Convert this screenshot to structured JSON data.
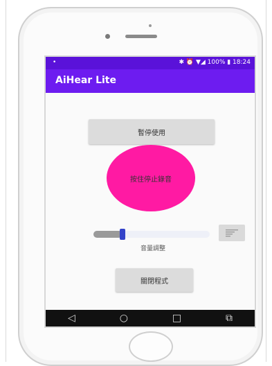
{
  "status_bar": {
    "left_icon": "notification-dot",
    "right_text": "✱ ⏰ ▼◢ 100% ▮ 18:24"
  },
  "app": {
    "title": "AiHear Lite"
  },
  "buttons": {
    "pause": "暫停使用",
    "record": "按住停止錄音",
    "close": "關閉程式"
  },
  "volume": {
    "label": "音量調整",
    "level_fraction": 0.25,
    "icon": "text-align-icon"
  },
  "nav": {
    "back": "◁",
    "home": "○",
    "recents": "□",
    "extra": "⧉"
  },
  "colors": {
    "status_bar": "#5a12d9",
    "app_bar": "#6d1cf0",
    "record_button": "#ff1aa3",
    "slider_thumb": "#3342c9"
  }
}
